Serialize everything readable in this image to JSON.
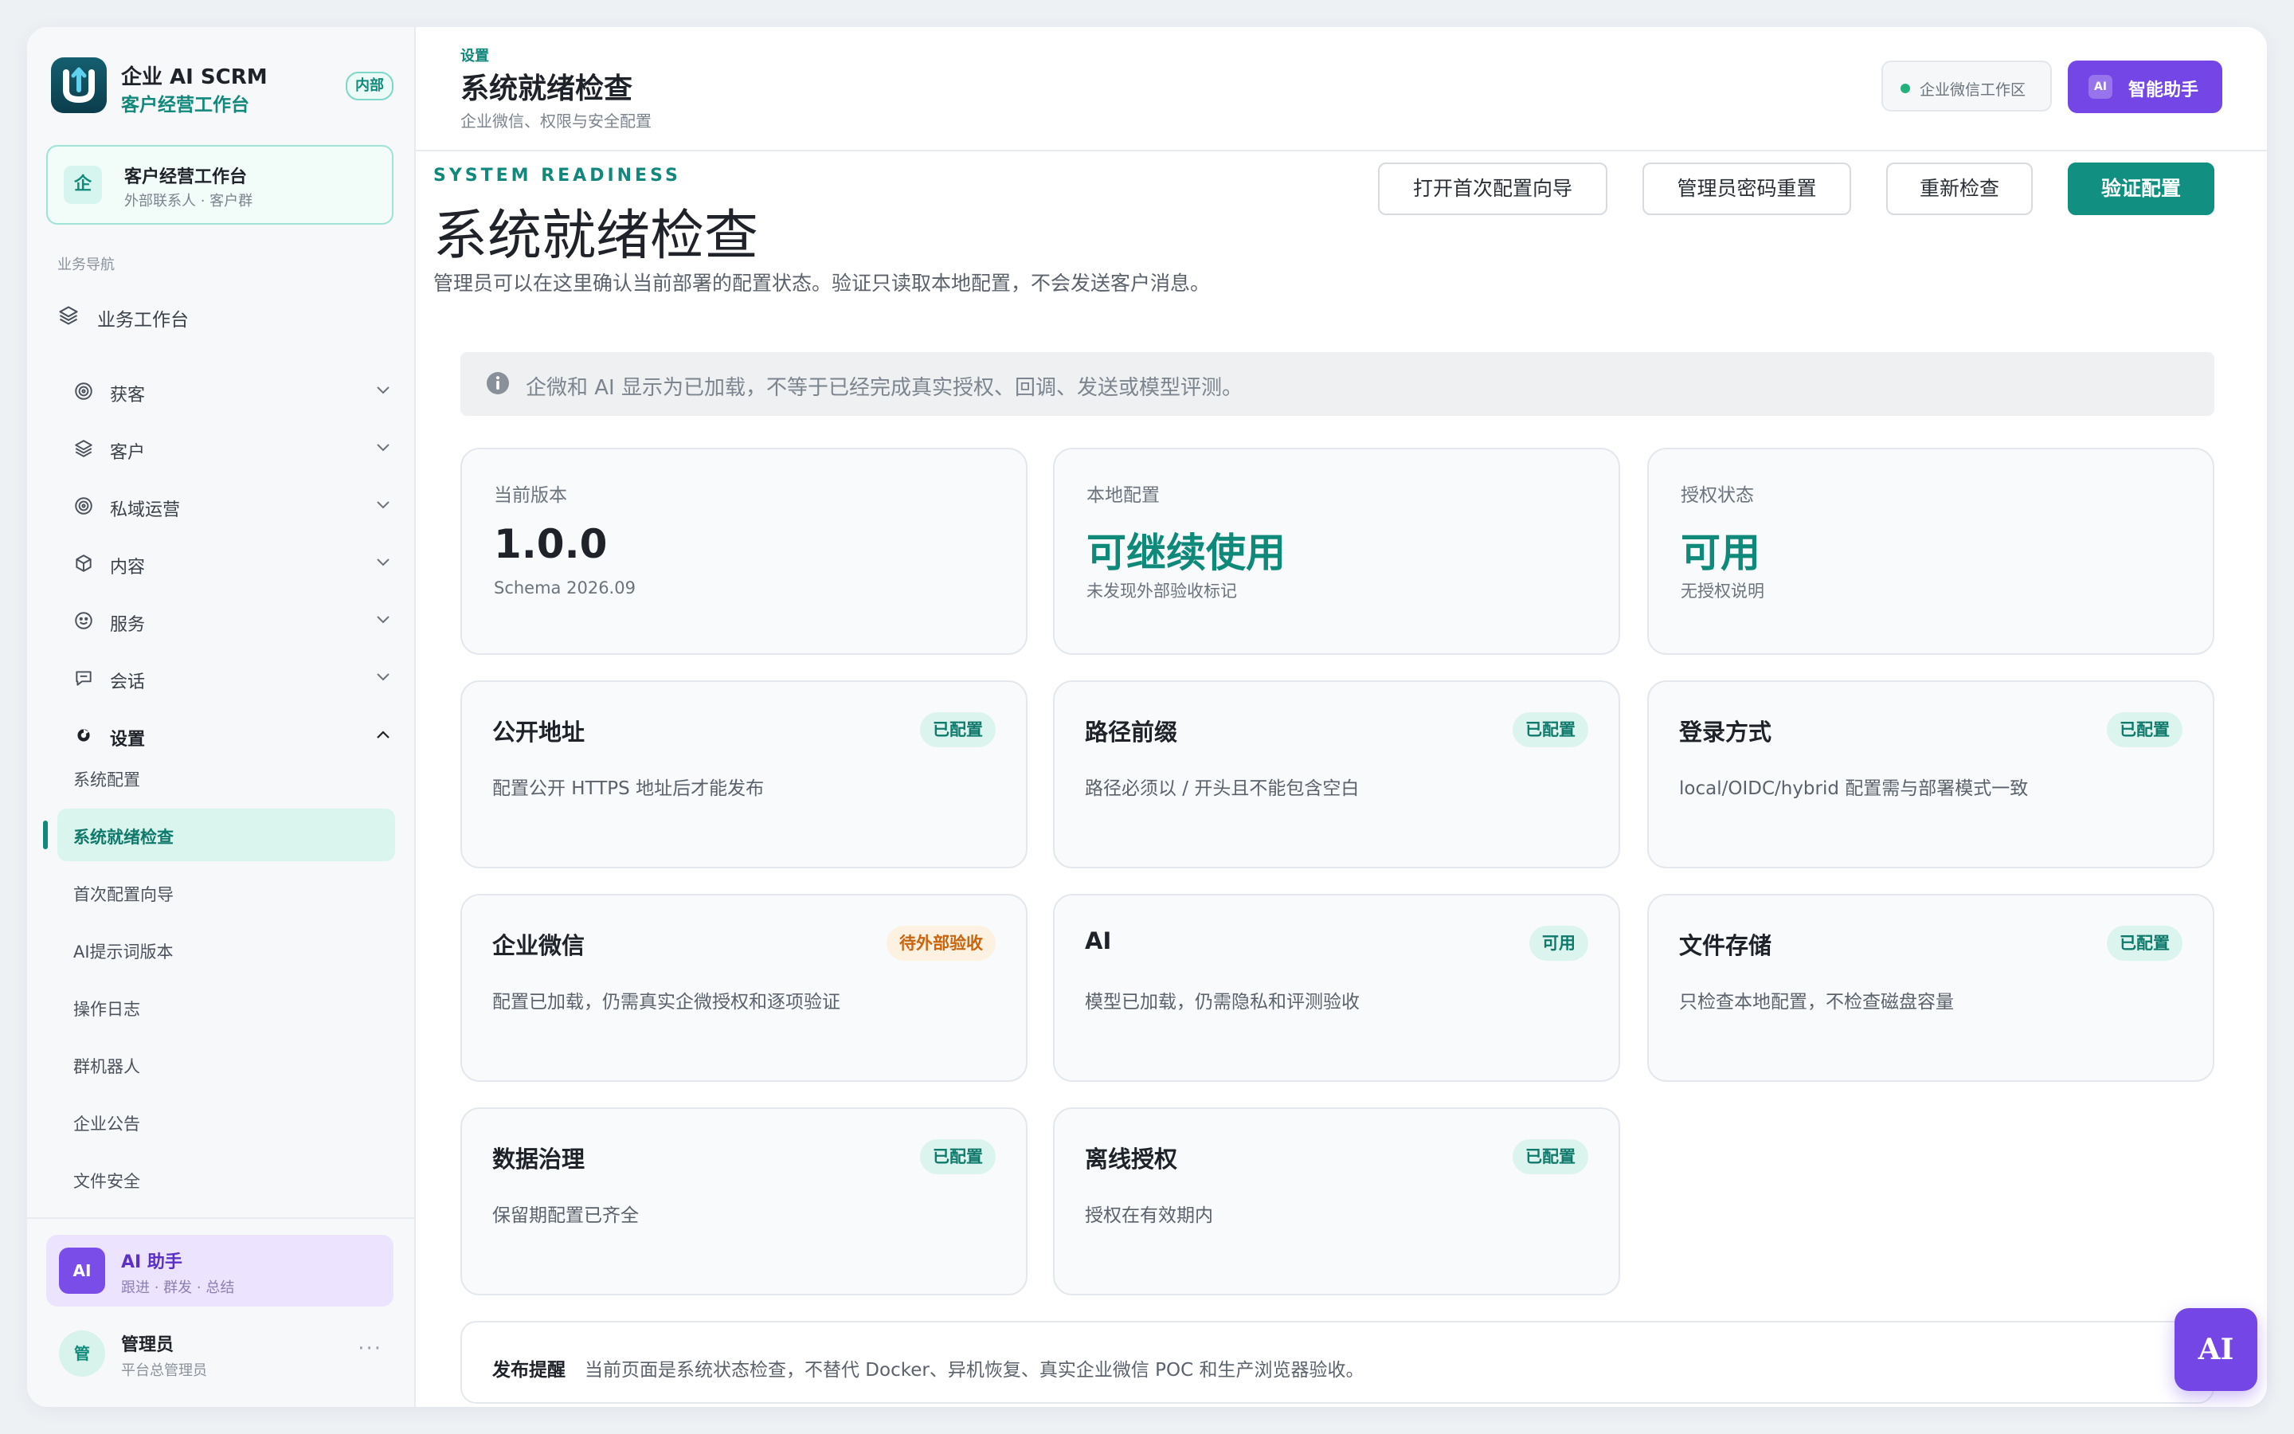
{
  "brand": {
    "name": "企业 AI SCRM",
    "subtitle": "客户经营工作台",
    "badge": "内部"
  },
  "workspace_card": {
    "icon_char": "企",
    "title": "客户经营工作台",
    "subtitle": "外部联系人 · 客户群"
  },
  "nav": {
    "section_label": "业务导航",
    "top": {
      "label": "业务工作台",
      "icon": "layers-icon"
    },
    "items": [
      {
        "label": "获客",
        "icon": "target-icon"
      },
      {
        "label": "客户",
        "icon": "layers-icon"
      },
      {
        "label": "私域运营",
        "icon": "target-icon"
      },
      {
        "label": "内容",
        "icon": "cube-icon"
      },
      {
        "label": "服务",
        "icon": "smile-icon"
      },
      {
        "label": "会话",
        "icon": "chat-icon"
      },
      {
        "label": "设置",
        "icon": "settings-icon"
      }
    ],
    "settings_sub": [
      "系统配置",
      "系统就绪检查",
      "首次配置向导",
      "AI提示词版本",
      "操作日志",
      "群机器人",
      "企业公告",
      "文件安全"
    ],
    "active_sub": "系统就绪检查"
  },
  "ai_card": {
    "avatar": "AI",
    "title": "AI 助手",
    "subtitle": "跟进 · 群发 · 总结"
  },
  "user": {
    "avatar": "管",
    "name": "管理员",
    "role": "平台总管理员",
    "more": "···"
  },
  "header": {
    "breadcrumb": "设置",
    "title": "系统就绪检查",
    "subtitle": "企业微信、权限与安全配置",
    "workspace_chip": "企业微信工作区",
    "assistant_icon": "AI",
    "assistant_button": "智能助手"
  },
  "main": {
    "eyebrow": "SYSTEM READINESS",
    "title": "系统就绪检查",
    "description": "管理员可以在这里确认当前部署的配置状态。验证只读取本地配置，不会发送客户消息。",
    "buttons": {
      "wizard": "打开首次配置向导",
      "reset_password": "管理员密码重置",
      "recheck": "重新检查",
      "verify": "验证配置"
    },
    "notice": "企微和 AI 显示为已加载，不等于已经完成真实授权、回调、发送或模型评测。",
    "stats": [
      {
        "label": "当前版本",
        "value": "1.0.0",
        "sub": "Schema 2026.09"
      },
      {
        "label": "本地配置",
        "value": "可继续使用",
        "sub": "未发现外部验收标记"
      },
      {
        "label": "授权状态",
        "value": "可用",
        "sub": "无授权说明"
      }
    ],
    "checks": [
      {
        "title": "公开地址",
        "badge": "已配置",
        "status": "ok",
        "desc": "配置公开 HTTPS 地址后才能发布"
      },
      {
        "title": "路径前缀",
        "badge": "已配置",
        "status": "ok",
        "desc": "路径必须以 / 开头且不能包含空白"
      },
      {
        "title": "登录方式",
        "badge": "已配置",
        "status": "ok",
        "desc": "local/OIDC/hybrid 配置需与部署模式一致"
      },
      {
        "title": "企业微信",
        "badge": "待外部验收",
        "status": "warn",
        "desc": "配置已加载，仍需真实企微授权和逐项验证"
      },
      {
        "title": "AI",
        "badge": "可用",
        "status": "ok",
        "desc": "模型已加载，仍需隐私和评测验收"
      },
      {
        "title": "文件存储",
        "badge": "已配置",
        "status": "ok",
        "desc": "只检查本地配置，不检查磁盘容量"
      },
      {
        "title": "数据治理",
        "badge": "已配置",
        "status": "ok",
        "desc": "保留期配置已齐全"
      },
      {
        "title": "离线授权",
        "badge": "已配置",
        "status": "ok",
        "desc": "授权在有效期内"
      }
    ],
    "release": {
      "label": "发布提醒",
      "text": "当前页面是系统状态检查，不替代 Docker、异机恢复、真实企业微信 POC 和生产浏览器验收。"
    }
  },
  "fab": {
    "label": "AI"
  },
  "colors": {
    "accent": "#118f80",
    "purple": "#7446e6",
    "warn": "#c9650e"
  }
}
